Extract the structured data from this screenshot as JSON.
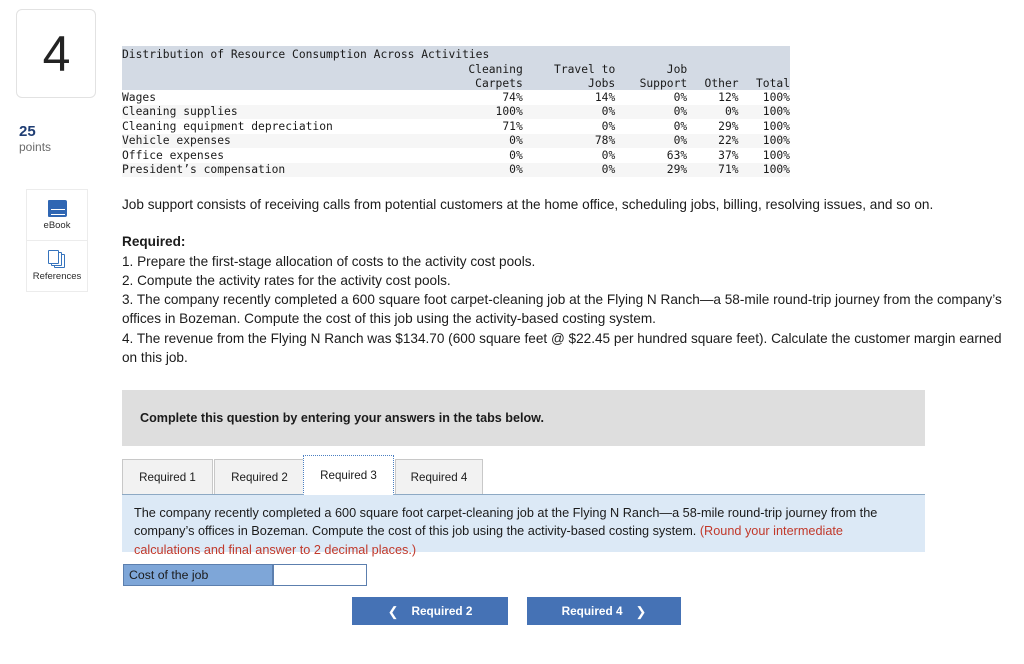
{
  "sidebar": {
    "question_number": "4",
    "points_value": "25",
    "points_label": "points",
    "tools": [
      {
        "icon": "ebook-icon",
        "label": "eBook"
      },
      {
        "icon": "references-icon",
        "label": "References"
      }
    ]
  },
  "table": {
    "title": "Distribution of Resource Consumption Across Activities",
    "columns": [
      {
        "line1": "",
        "line2": ""
      },
      {
        "line1": "Cleaning",
        "line2": "Carpets"
      },
      {
        "line1": "Travel to",
        "line2": "Jobs"
      },
      {
        "line1": "Job",
        "line2": "Support"
      },
      {
        "line1": "",
        "line2": "Other"
      },
      {
        "line1": "",
        "line2": "Total"
      }
    ],
    "rows": [
      {
        "label": "Wages",
        "values": [
          "74%",
          "14%",
          "0%",
          "12%",
          "100%"
        ]
      },
      {
        "label": "Cleaning supplies",
        "values": [
          "100%",
          "0%",
          "0%",
          "0%",
          "100%"
        ]
      },
      {
        "label": "Cleaning equipment depreciation",
        "values": [
          "71%",
          "0%",
          "0%",
          "29%",
          "100%"
        ]
      },
      {
        "label": "Vehicle expenses",
        "values": [
          "0%",
          "78%",
          "0%",
          "22%",
          "100%"
        ]
      },
      {
        "label": "Office expenses",
        "values": [
          "0%",
          "0%",
          "63%",
          "37%",
          "100%"
        ]
      },
      {
        "label": "President’s compensation",
        "values": [
          "0%",
          "0%",
          "29%",
          "71%",
          "100%"
        ]
      }
    ]
  },
  "body": {
    "intro": "Job support consists of receiving calls from potential customers at the home office, scheduling jobs, billing, resolving issues, and so on.",
    "required_heading": "Required:",
    "requirements": [
      "1. Prepare the first-stage allocation of costs to the activity cost pools.",
      "2. Compute the activity rates for the activity cost pools.",
      "3. The company recently completed a 600 square foot carpet-cleaning job at the Flying N Ranch—a 58-mile round-trip journey from the company’s offices in Bozeman. Compute the cost of this job using the activity-based costing system.",
      "4. The revenue from the Flying N Ranch was $134.70 (600 square feet @ $22.45 per hundred square feet). Calculate the customer margin earned on this job."
    ]
  },
  "banner": {
    "text": "Complete this question by entering your answers in the tabs below."
  },
  "tabs": {
    "items": [
      {
        "label": "Required 1",
        "active": false
      },
      {
        "label": "Required 2",
        "active": false
      },
      {
        "label": "Required 3",
        "active": true
      },
      {
        "label": "Required 4",
        "active": false
      }
    ]
  },
  "answer_panel": {
    "prompt": "The company recently completed a 600 square foot carpet-cleaning job at the Flying N Ranch—a 58-mile round-trip journey from the company’s offices in Bozeman. Compute the cost of this job using the activity-based costing system. ",
    "rounding_note": "(Round your intermediate calculations and final answer to 2 decimal places.)",
    "row_label": "Cost of the job",
    "input_value": "",
    "input_placeholder": ""
  },
  "nav": {
    "prev_label": "Required 2",
    "prev_icon": "chevron-left-icon",
    "next_label": "Required 4",
    "next_icon": "chevron-right-icon"
  },
  "colors": {
    "accent_blue": "#4572b5",
    "table_header": "#d3dae4",
    "panel_blue": "#dce9f6",
    "banner_gray": "#dedede",
    "red_note": "#c1392b",
    "points_navy": "#1f3d73"
  }
}
